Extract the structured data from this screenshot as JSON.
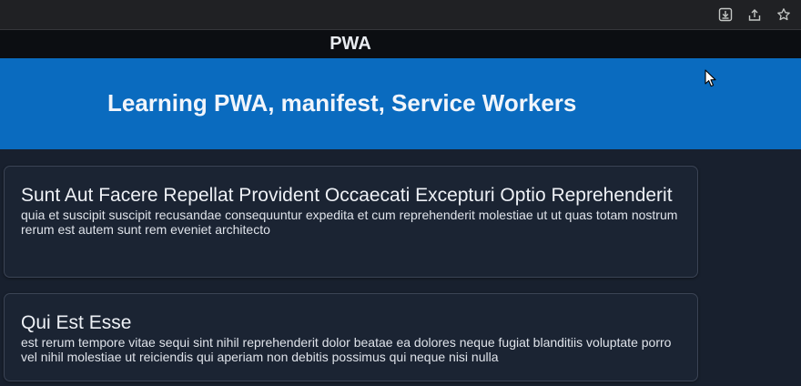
{
  "browser": {
    "icons": [
      "download-icon",
      "share-icon",
      "star-icon"
    ]
  },
  "app": {
    "title": "PWA"
  },
  "hero": {
    "title": "Learning PWA, manifest, Service Workers"
  },
  "posts": [
    {
      "title": "Sunt Aut Facere Repellat Provident Occaecati Excepturi Optio Reprehenderit",
      "body": "quia et suscipit suscipit recusandae consequuntur expedita et cum reprehenderit molestiae ut ut quas totam nostrum rerum est autem sunt rem eveniet architecto"
    },
    {
      "title": "Qui Est Esse",
      "body": "est rerum tempore vitae sequi sint nihil reprehenderit dolor beatae ea dolores neque fugiat blanditiis voluptate porro vel nihil molestiae ut reiciendis qui aperiam non debitis possimus qui neque nisi nulla"
    }
  ],
  "colors": {
    "hero_background": "#0a6bbf",
    "page_background": "#18202e",
    "header_background": "#0c0e12",
    "card_background": "#1b2433"
  }
}
